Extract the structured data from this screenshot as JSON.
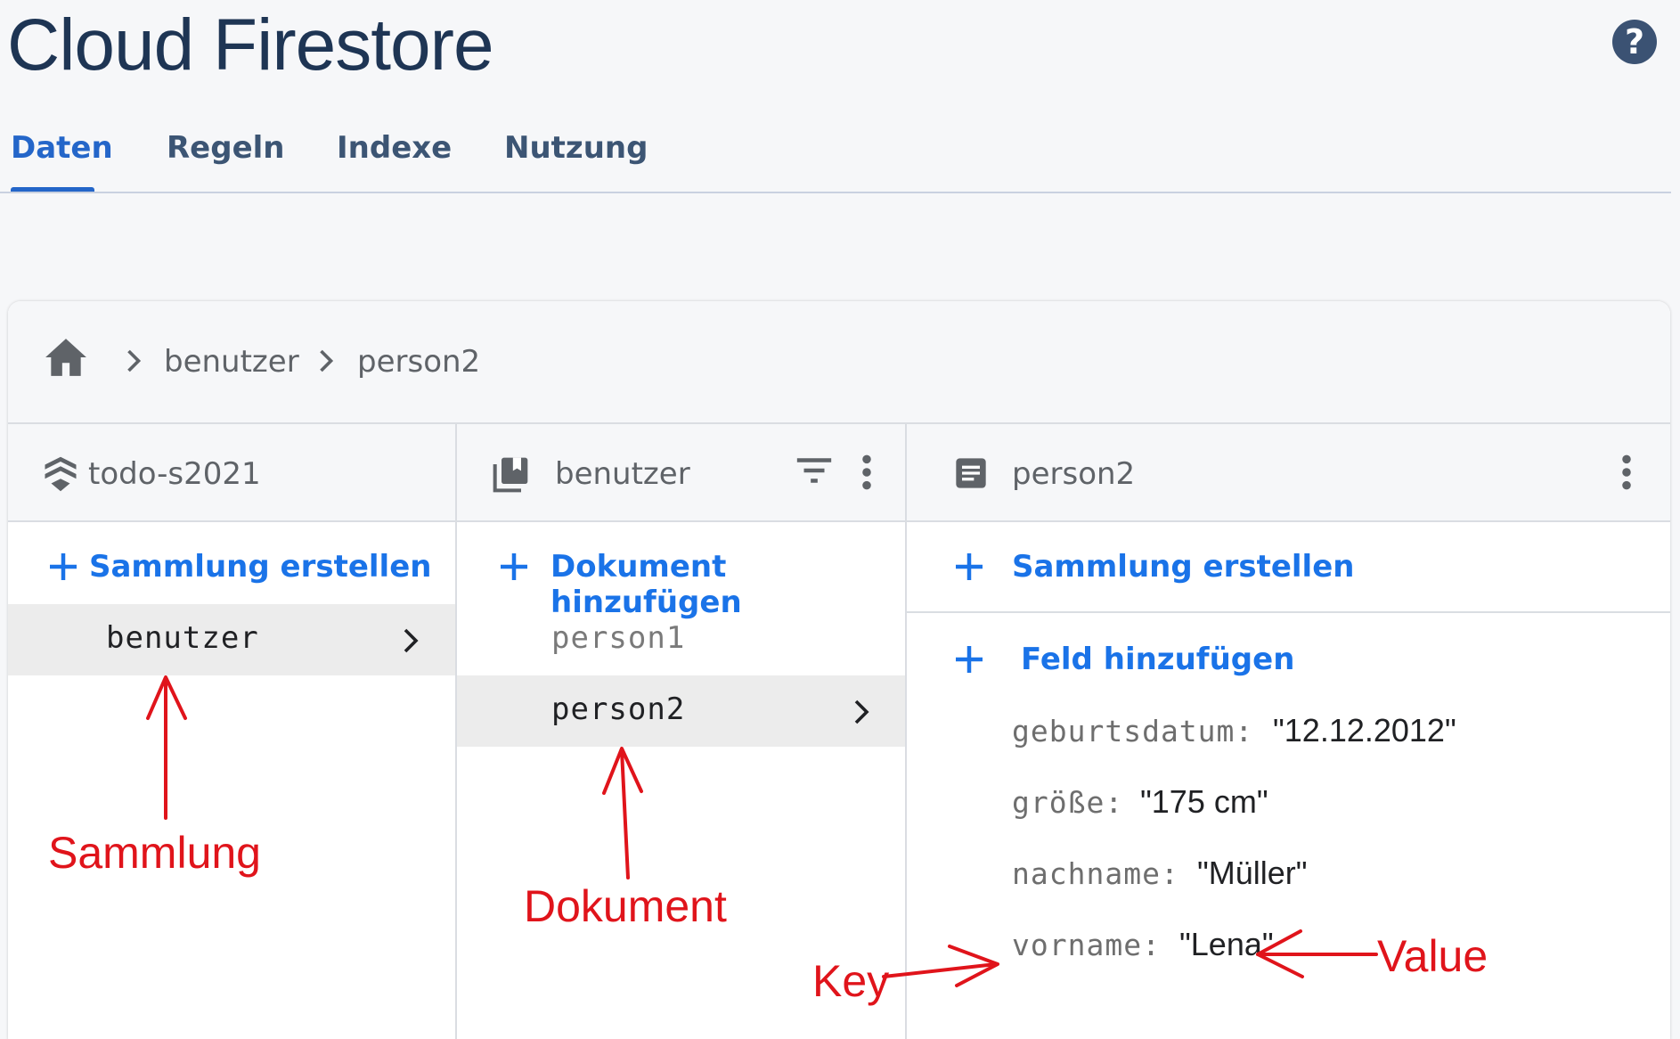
{
  "header": {
    "title": "Cloud Firestore",
    "help_label": "?",
    "help_icon": "help-circle-icon"
  },
  "tabs": [
    {
      "label": "Daten",
      "active": true
    },
    {
      "label": "Regeln",
      "active": false
    },
    {
      "label": "Indexe",
      "active": false
    },
    {
      "label": "Nutzung",
      "active": false
    }
  ],
  "breadcrumb": {
    "home_icon": "home-icon",
    "items": [
      "benutzer",
      "person2"
    ]
  },
  "columns": {
    "project": {
      "title": "todo-s2021",
      "icon": "firestore-stack-icon",
      "add_label": "Sammlung erstellen",
      "items": [
        {
          "label": "benutzer",
          "selected": true
        }
      ]
    },
    "collection": {
      "title": "benutzer",
      "icon": "collection-icon",
      "add_label": "Dokument hinzufügen",
      "items": [
        {
          "label": "person1",
          "selected": false
        },
        {
          "label": "person2",
          "selected": true
        }
      ]
    },
    "document": {
      "title": "person2",
      "icon": "document-icon",
      "add_collection_label": "Sammlung erstellen",
      "add_field_label": "Feld hinzufügen",
      "fields": [
        {
          "key": "geburtsdatum:",
          "value": "\"12.12.2012\""
        },
        {
          "key": "größe:",
          "value": "\"175 cm\""
        },
        {
          "key": "nachname:",
          "value": "\"Müller\""
        },
        {
          "key": "vorname:",
          "value": "\"Lena\""
        }
      ]
    }
  },
  "annotations": {
    "sammlung": "Sammlung",
    "dokument": "Dokument",
    "key": "Key",
    "value": "Value",
    "color": "#e0141b"
  },
  "colors": {
    "accent": "#1a73e8",
    "tab_active": "#2466c9",
    "title": "#1e3554"
  }
}
